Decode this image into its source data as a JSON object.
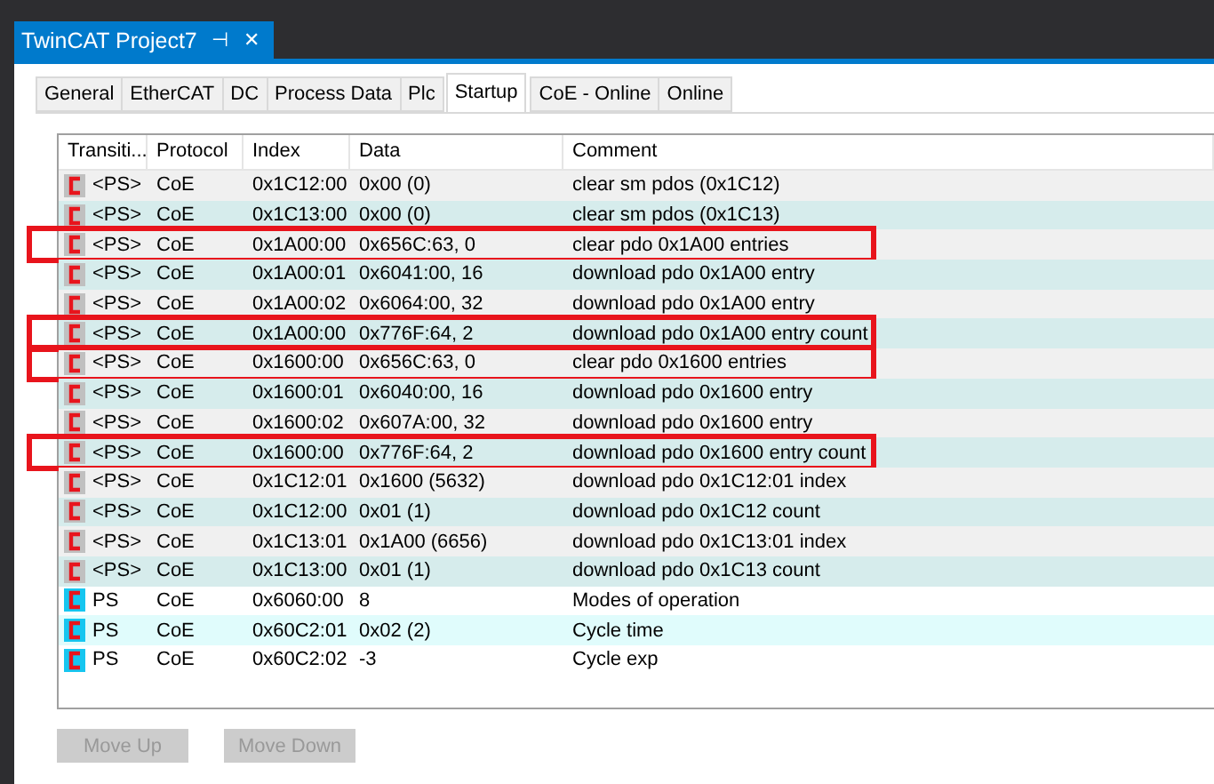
{
  "document_tab": {
    "title": "TwinCAT Project7",
    "pin": "⊣",
    "close": "✕"
  },
  "tabs": [
    {
      "label": "General",
      "selected": false
    },
    {
      "label": "EtherCAT",
      "selected": false
    },
    {
      "label": "DC",
      "selected": false
    },
    {
      "label": "Process Data",
      "selected": false
    },
    {
      "label": "Plc",
      "selected": false
    },
    {
      "label": "Startup",
      "selected": true
    },
    {
      "label": "CoE - Online",
      "selected": false
    },
    {
      "label": "Online",
      "selected": false
    }
  ],
  "table": {
    "columns": [
      "Transiti...",
      "Protocol",
      "Index",
      "Data",
      "Comment"
    ],
    "rows": [
      {
        "kind": "fixed",
        "highlighted": false,
        "cells": [
          "<PS>",
          "CoE",
          "0x1C12:00",
          "0x00 (0)",
          "clear sm pdos (0x1C12)"
        ]
      },
      {
        "kind": "fixed",
        "highlighted": false,
        "cells": [
          "<PS>",
          "CoE",
          "0x1C13:00",
          "0x00 (0)",
          "clear sm pdos (0x1C13)"
        ]
      },
      {
        "kind": "fixed",
        "highlighted": true,
        "cells": [
          "<PS>",
          "CoE",
          "0x1A00:00",
          "0x656C:63, 0",
          "clear pdo 0x1A00 entries"
        ]
      },
      {
        "kind": "fixed",
        "highlighted": false,
        "cells": [
          "<PS>",
          "CoE",
          "0x1A00:01",
          "0x6041:00, 16",
          "download pdo 0x1A00 entry"
        ]
      },
      {
        "kind": "fixed",
        "highlighted": false,
        "cells": [
          "<PS>",
          "CoE",
          "0x1A00:02",
          "0x6064:00, 32",
          "download pdo 0x1A00 entry"
        ]
      },
      {
        "kind": "fixed",
        "highlighted": true,
        "cells": [
          "<PS>",
          "CoE",
          "0x1A00:00",
          "0x776F:64, 2",
          "download pdo 0x1A00 entry count"
        ]
      },
      {
        "kind": "fixed",
        "highlighted": true,
        "cells": [
          "<PS>",
          "CoE",
          "0x1600:00",
          "0x656C:63, 0",
          "clear pdo 0x1600 entries"
        ]
      },
      {
        "kind": "fixed",
        "highlighted": false,
        "cells": [
          "<PS>",
          "CoE",
          "0x1600:01",
          "0x6040:00, 16",
          "download pdo 0x1600 entry"
        ]
      },
      {
        "kind": "fixed",
        "highlighted": false,
        "cells": [
          "<PS>",
          "CoE",
          "0x1600:02",
          "0x607A:00, 32",
          "download pdo 0x1600 entry"
        ]
      },
      {
        "kind": "fixed",
        "highlighted": true,
        "cells": [
          "<PS>",
          "CoE",
          "0x1600:00",
          "0x776F:64, 2",
          "download pdo 0x1600 entry count"
        ]
      },
      {
        "kind": "fixed",
        "highlighted": false,
        "cells": [
          "<PS>",
          "CoE",
          "0x1C12:01",
          "0x1600 (5632)",
          "download pdo 0x1C12:01 index"
        ]
      },
      {
        "kind": "fixed",
        "highlighted": false,
        "cells": [
          "<PS>",
          "CoE",
          "0x1C12:00",
          "0x01 (1)",
          "download pdo 0x1C12 count"
        ]
      },
      {
        "kind": "fixed",
        "highlighted": false,
        "cells": [
          "<PS>",
          "CoE",
          "0x1C13:01",
          "0x1A00 (6656)",
          "download pdo 0x1C13:01 index"
        ]
      },
      {
        "kind": "fixed",
        "highlighted": false,
        "cells": [
          "<PS>",
          "CoE",
          "0x1C13:00",
          "0x01 (1)",
          "download pdo 0x1C13 count"
        ]
      },
      {
        "kind": "user",
        "highlighted": false,
        "cells": [
          "PS",
          "CoE",
          "0x6060:00",
          "8",
          "Modes of operation"
        ]
      },
      {
        "kind": "user",
        "highlighted": false,
        "cells": [
          "PS",
          "CoE",
          "0x60C2:01",
          "0x02 (2)",
          "Cycle time"
        ]
      },
      {
        "kind": "user",
        "highlighted": false,
        "cells": [
          "PS",
          "CoE",
          "0x60C2:02",
          "-3",
          "Cycle exp"
        ]
      }
    ]
  },
  "buttons": [
    {
      "label": "Move Up",
      "disabled": true
    },
    {
      "label": "Move Down",
      "disabled": true
    }
  ]
}
